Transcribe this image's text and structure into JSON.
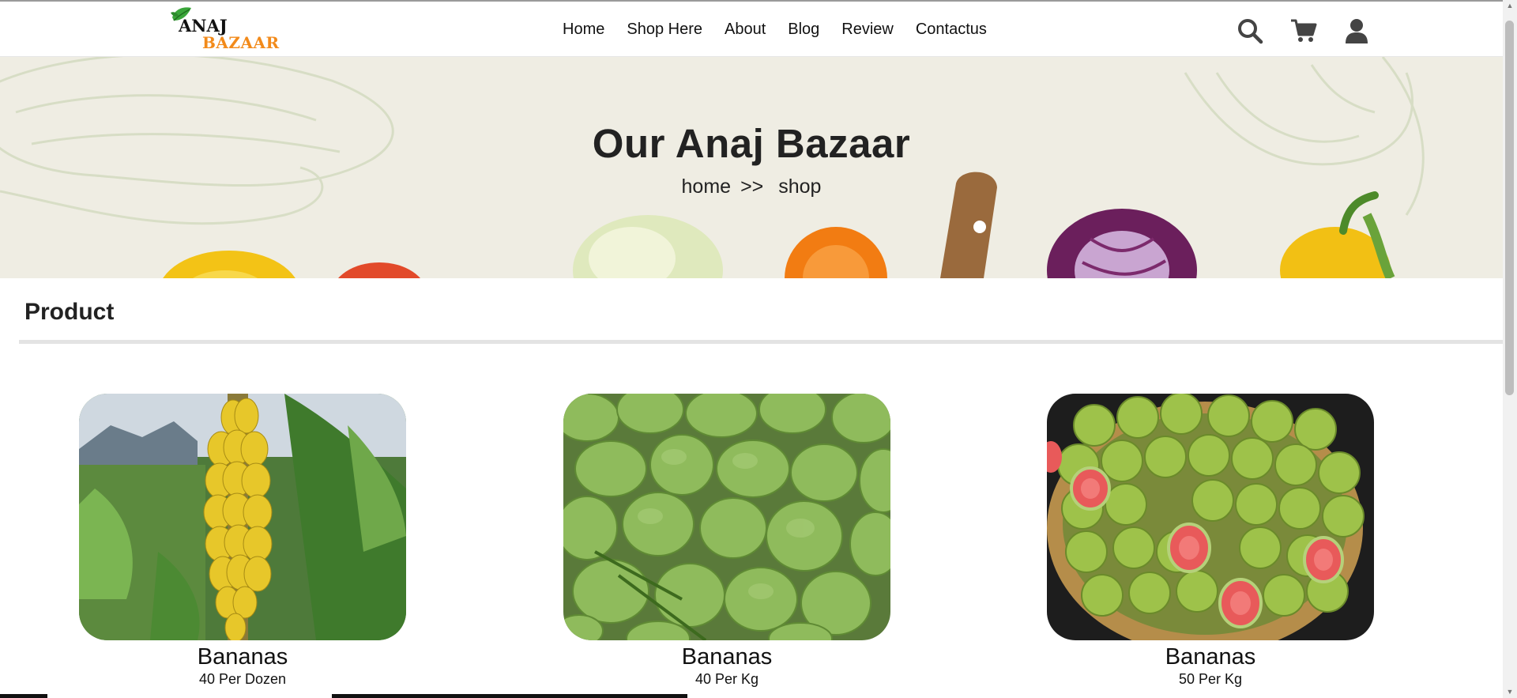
{
  "brand": {
    "line1": "ANAJ",
    "line2": "BAZAAR"
  },
  "nav": {
    "items": [
      {
        "label": "Home"
      },
      {
        "label": "Shop Here"
      },
      {
        "label": "About"
      },
      {
        "label": "Blog"
      },
      {
        "label": "Review"
      },
      {
        "label": "Contactus"
      }
    ]
  },
  "header_icons": [
    "search-icon",
    "cart-icon",
    "user-icon"
  ],
  "banner": {
    "title": "Our Anaj Bazaar",
    "breadcrumb": {
      "home": "home",
      "separator": ">>",
      "current": "shop"
    }
  },
  "section": {
    "title": "Product"
  },
  "products": [
    {
      "name": "Bananas",
      "price": "40 Per Dozen",
      "image": "banana-bunch"
    },
    {
      "name": "Bananas",
      "price": "40 Per Kg",
      "image": "green-mangoes"
    },
    {
      "name": "Bananas",
      "price": "50 Per Kg",
      "image": "guava-basket"
    }
  ],
  "colors": {
    "accent": "#f28a1a",
    "banner_bg": "#efede3",
    "leaf": "#3aa63a"
  }
}
